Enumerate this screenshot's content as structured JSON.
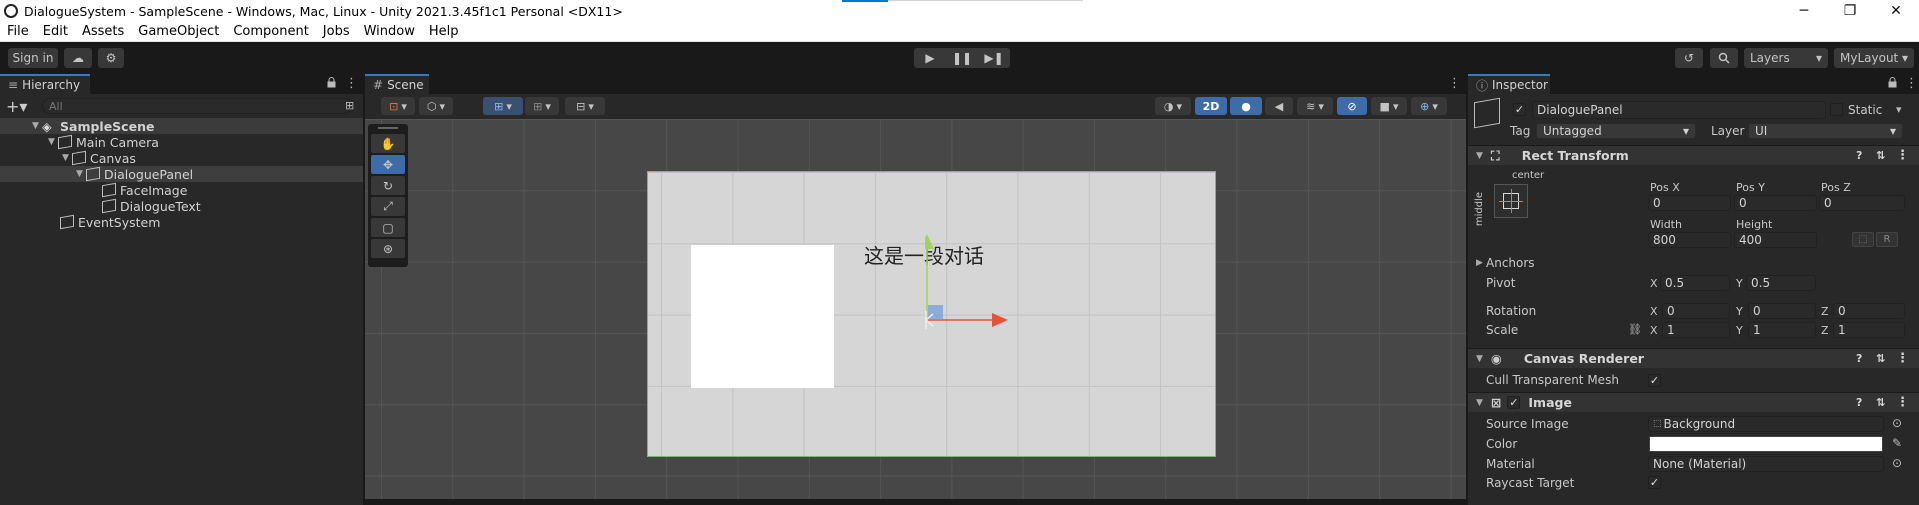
{
  "window": {
    "title": "DialogueSystem - SampleScene - Windows, Mac, Linux - Unity 2021.3.45f1c1 Personal <DX11>",
    "minimize": "─",
    "maximize": "❐",
    "close": "✕"
  },
  "menu": [
    "File",
    "Edit",
    "Assets",
    "GameObject",
    "Component",
    "Jobs",
    "Window",
    "Help"
  ],
  "toolbar": {
    "sign_in": "Sign in",
    "cloud": "☁",
    "collab": "⚙",
    "play": "▶",
    "pause": "❚❚",
    "step": "▶❚",
    "history": "↺",
    "search": "🔍",
    "layers_label": "Layers",
    "layout_label": "MyLayout",
    "dropdown_arrow": "▾"
  },
  "hierarchy": {
    "tab_label": "Hierarchy",
    "tab_icon": "≡",
    "lock": "🔒",
    "menu": "⋮",
    "add": "+▾",
    "search_placeholder": "All",
    "items": [
      {
        "label": "SampleScene",
        "depth": 0,
        "expanded": true,
        "type": "scene"
      },
      {
        "label": "Main Camera",
        "depth": 1,
        "expanded": false,
        "type": "object"
      },
      {
        "label": "Canvas",
        "depth": 1,
        "expanded": true,
        "type": "object"
      },
      {
        "label": "DialoguePanel",
        "depth": 2,
        "expanded": true,
        "type": "object",
        "selected": true
      },
      {
        "label": "FaceImage",
        "depth": 3,
        "expanded": false,
        "type": "object"
      },
      {
        "label": "DialogueText",
        "depth": 3,
        "expanded": false,
        "type": "object"
      },
      {
        "label": "EventSystem",
        "depth": 1,
        "expanded": false,
        "type": "object"
      }
    ]
  },
  "scene": {
    "tab_label": "Scene",
    "tab_icon": "#",
    "menu": "⋮",
    "mode_2d": "2D",
    "dialogue_text": "这是一段对话",
    "tools": [
      "hand-tool",
      "move-tool",
      "rotate-tool",
      "scale-tool",
      "rect-tool",
      "transform-tool"
    ],
    "active_tool": "move-tool"
  },
  "inspector": {
    "tab_label": "Inspector",
    "tab_icon": "ⓘ",
    "lock": "🔒",
    "menu": "⋮",
    "object_name": "DialoguePanel",
    "active_checked": true,
    "static_label": "Static",
    "tag_label": "Tag",
    "tag_value": "Untagged",
    "layer_label": "Layer",
    "layer_value": "UI",
    "rect_transform": {
      "title": "Rect Transform",
      "anchor_h": "center",
      "anchor_v": "middle",
      "pos_x_label": "Pos X",
      "pos_y_label": "Pos Y",
      "pos_z_label": "Pos Z",
      "pos_x": "0",
      "pos_y": "0",
      "pos_z": "0",
      "width_label": "Width",
      "height_label": "Height",
      "width": "800",
      "height": "400",
      "r_button": "R",
      "anchors_label": "Anchors",
      "pivot_label": "Pivot",
      "pivot_x": "0.5",
      "pivot_y": "0.5",
      "rotation_label": "Rotation",
      "rot_x": "0",
      "rot_y": "0",
      "rot_z": "0",
      "scale_label": "Scale",
      "scale_x": "1",
      "scale_y": "1",
      "scale_z": "1",
      "x_label": "X",
      "y_label": "Y",
      "z_label": "Z"
    },
    "canvas_renderer": {
      "title": "Canvas Renderer",
      "cull_label": "Cull Transparent Mesh",
      "cull_checked": true
    },
    "image": {
      "title": "Image",
      "enabled": true,
      "source_image_label": "Source Image",
      "source_image_value": "Background",
      "color_label": "Color",
      "color_value": "#ffffff",
      "material_label": "Material",
      "material_value": "None (Material)",
      "raycast_label": "Raycast Target",
      "raycast_checked": true
    },
    "header_icons": {
      "help": "?",
      "preset": "⇅",
      "menu": "⋮"
    },
    "check": "✓"
  },
  "colors": {
    "accent_blue": "#3a79bb",
    "selection_green": "#6bc36b",
    "background_dark": "#191919",
    "panel": "#282828"
  }
}
